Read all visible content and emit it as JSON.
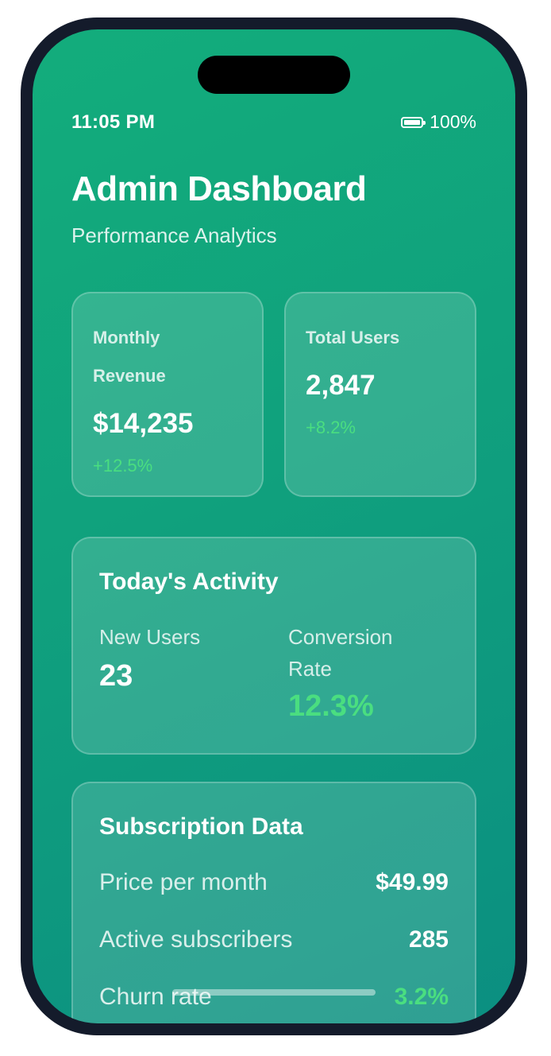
{
  "status_bar": {
    "time": "11:05 PM",
    "battery": "100%"
  },
  "header": {
    "title": "Admin Dashboard",
    "subtitle": "Performance Analytics"
  },
  "stats": [
    {
      "label": "Monthly Revenue",
      "value": "$14,235",
      "change": "+12.5%"
    },
    {
      "label": "Total Users",
      "value": "2,847",
      "change": "+8.2%"
    }
  ],
  "activity": {
    "title": "Today's Activity",
    "new_users_label": "New Users",
    "new_users_value": "23",
    "conversion_label": "Conversion Rate",
    "conversion_value": "12.3%"
  },
  "subscription": {
    "title": "Subscription Data",
    "rows": [
      {
        "label": "Price per month",
        "value": "$49.99"
      },
      {
        "label": "Active subscribers",
        "value": "285"
      },
      {
        "label": "Churn rate",
        "value": "3.2%"
      }
    ]
  },
  "colors": {
    "gradient_start": "#13ad7c",
    "gradient_end": "#0b8f81",
    "positive": "#4ade80",
    "frame": "#141b2b"
  },
  "icons": {
    "battery": "battery-icon"
  }
}
